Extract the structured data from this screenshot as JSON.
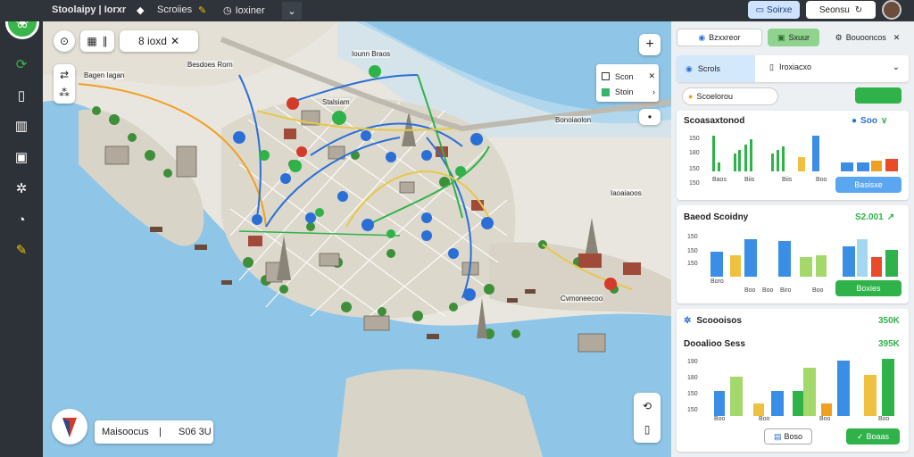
{
  "topbar": {
    "app_title": "Stoolaipy | Iorxr",
    "nav_item_1": "Scroiies",
    "nav_item_2": "Ioxiner",
    "btn_primary": "Soirxe",
    "btn_secondary": "Seonsu"
  },
  "map": {
    "layer_chip": "8 ioxd",
    "legend": [
      {
        "label": "Scon",
        "color": "#ffffff"
      },
      {
        "label": "Stoin",
        "color": "#3ab36a"
      }
    ],
    "labels": [
      "Bagen Iagan",
      "Besdoes Rorn",
      "Iounn Braos",
      "Stalsiam",
      "Bonoiaolon",
      "Iaoaiaoos",
      "Cvmoneecoo"
    ],
    "search": {
      "left": "Maisoocus",
      "sep": "|",
      "right": "S06 3U"
    },
    "colors": {
      "water": "#8fc6e8",
      "route_blue": "#2a6fd6",
      "route_green": "#2fb24a",
      "route_orange": "#f0a020",
      "route_yellow": "#e6c84a"
    }
  },
  "panel": {
    "tabs": [
      {
        "label": "Bzxxreor",
        "active": false
      },
      {
        "label": "Sxuur",
        "active": true
      },
      {
        "label": "Bouooncos",
        "active": false
      }
    ],
    "selector": {
      "left": "Scrols",
      "right": "Iroxiacxo"
    },
    "action_row": {
      "label": "Scoelorou",
      "button": ""
    },
    "card1": {
      "title": "Scoasaxtonod",
      "value": "Soo",
      "y_ticks": [
        "150",
        "180",
        "150",
        "150"
      ],
      "x_labels": [
        "Baos",
        "Biis",
        "Biis",
        "Boo"
      ],
      "button": "Basisxe"
    },
    "card2": {
      "title": "Baeod Scoidny",
      "value": "S2.001",
      "y_ticks": [
        "150",
        "150",
        "150"
      ],
      "x_labels": [
        "Boro",
        "Boo",
        "Boo",
        "Biro",
        "Boo"
      ],
      "button": "Boxies"
    },
    "card3": {
      "title": "Scoooisos",
      "value": "350K",
      "subtitle": "Dooalioo Sess",
      "subvalue": "395K",
      "y_ticks": [
        "190",
        "180",
        "150",
        "150"
      ],
      "x_labels": [
        "Boo",
        "Boo",
        "Boo",
        "Boo"
      ],
      "button_left": "Boso",
      "button_right": "Boaas"
    }
  }
}
